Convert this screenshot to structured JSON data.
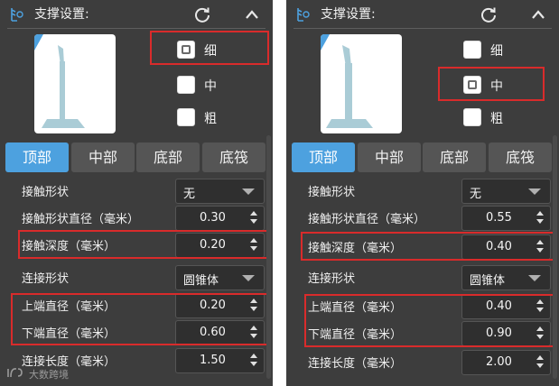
{
  "panels": [
    {
      "title": "支撑设置:",
      "options": [
        {
          "label": "细",
          "checked": true
        },
        {
          "label": "中",
          "checked": false
        },
        {
          "label": "粗",
          "checked": false
        }
      ],
      "tabs": [
        "顶部",
        "中部",
        "底部",
        "底筏"
      ],
      "active_tab": "顶部",
      "rows": [
        {
          "label": "接触形状",
          "value": "无",
          "type": "select"
        },
        {
          "label": "接触形状直径（毫米）",
          "value": "0.30",
          "type": "spin"
        },
        {
          "label": "接触深度（毫米）",
          "value": "0.20",
          "type": "spin"
        },
        {
          "label": "连接形状",
          "value": "圆锥体",
          "type": "select"
        },
        {
          "label": "上端直径（毫米）",
          "value": "0.20",
          "type": "spin"
        },
        {
          "label": "下端直径（毫米）",
          "value": "0.60",
          "type": "spin"
        },
        {
          "label": "连接长度（毫米）",
          "value": "1.50",
          "type": "spin"
        }
      ]
    },
    {
      "title": "支撑设置:",
      "options": [
        {
          "label": "细",
          "checked": false
        },
        {
          "label": "中",
          "checked": true
        },
        {
          "label": "粗",
          "checked": false
        }
      ],
      "tabs": [
        "顶部",
        "中部",
        "底部",
        "底筏"
      ],
      "active_tab": "顶部",
      "rows": [
        {
          "label": "接触形状",
          "value": "无",
          "type": "select"
        },
        {
          "label": "接触形状直径（毫米）",
          "value": "0.55",
          "type": "spin"
        },
        {
          "label": "接触深度（毫米）",
          "value": "0.40",
          "type": "spin"
        },
        {
          "label": "连接形状",
          "value": "圆锥体",
          "type": "select"
        },
        {
          "label": "上端直径（毫米）",
          "value": "0.40",
          "type": "spin"
        },
        {
          "label": "下端直径（毫米）",
          "value": "0.90",
          "type": "spin"
        },
        {
          "label": "连接长度（毫米）",
          "value": "2.00",
          "type": "spin"
        }
      ]
    }
  ],
  "watermark": "大数跨境",
  "icons": {
    "header_left": "support-settings-icon",
    "refresh": "refresh-icon",
    "collapse": "chevron-up-icon"
  },
  "colors": {
    "panel_bg": "#3d3d3d",
    "accent": "#4da1df",
    "highlight": "#d92b2b"
  }
}
